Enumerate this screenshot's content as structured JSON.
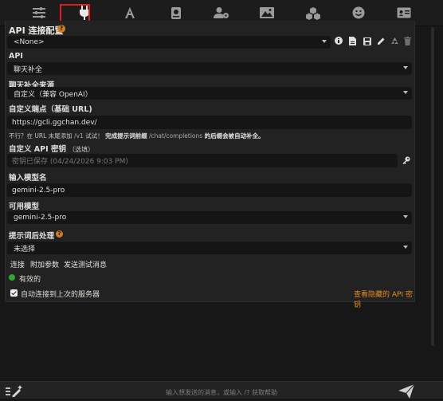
{
  "topbar": {
    "icons": [
      "sliders-icon",
      "plug-icon",
      "font-a-icon",
      "book-icon",
      "user-gear-icon",
      "image-icon",
      "cubes-icon",
      "smiley-icon",
      "id-card-icon"
    ]
  },
  "api_config": {
    "title": "API 连接配置",
    "help_icon": "?",
    "profile_select": "<None>"
  },
  "api": {
    "label": "API",
    "value": "聊天补全"
  },
  "source": {
    "label": "聊天补全来源",
    "value": "自定义（兼容 OpenAI）"
  },
  "endpoint": {
    "label": "自定义端点（基础 URL)",
    "value": "https://gcli.ggchan.dev/",
    "hint_prefix": "不行？在 URL 末尾添加",
    "hint_code1": "/v1",
    "hint_middle": "试试！",
    "hint_bold": "完成提示词前缀",
    "hint_code2": "/chat/completions",
    "hint_suffix": "的后缀会被自动补全。"
  },
  "api_key": {
    "label": "自定义 API 密钥",
    "label_optional": "（选填）",
    "placeholder": "密钥已保存 (04/24/2026 9:03 PM)"
  },
  "model_name": {
    "label": "输入模型名",
    "value": "gemini-2.5-pro"
  },
  "available_models": {
    "label": "可用模型",
    "value": "gemini-2.5-pro"
  },
  "postprocess": {
    "label": "提示词后处理",
    "value": "未选择"
  },
  "actions": {
    "connect": "连接",
    "extra_params": "附加参数",
    "send_test": "发送测试消息"
  },
  "status": {
    "text": "有效的",
    "color": "#2fa82f"
  },
  "auto_connect": {
    "label": "自动连接到上次的服务器",
    "checked": true
  },
  "hidden_keys_link": "查看隐藏的 API 密钥",
  "chat": {
    "placeholder": "输入想发送的消息，或输入 /? 获取帮助"
  },
  "colors": {
    "accent_orange": "#e38a24",
    "highlight_red": "#e01c1c"
  }
}
